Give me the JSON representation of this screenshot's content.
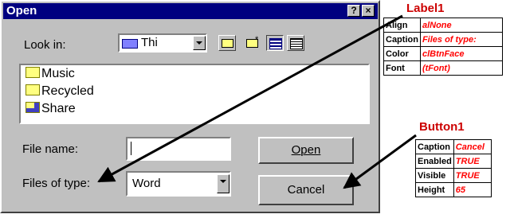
{
  "dialog": {
    "title": "Open",
    "help_glyph": "?",
    "close_glyph": "×",
    "look_in_label": "Look in:",
    "look_in_value": "Thi",
    "folders": [
      {
        "label": "Music",
        "icon": "folder-icon"
      },
      {
        "label": "Recycled",
        "icon": "folder-icon"
      },
      {
        "label": "Share",
        "icon": "shared-folder-icon"
      }
    ],
    "file_name_label": "File name:",
    "file_name_value": "",
    "files_of_type_label": "Files of type:",
    "files_of_type_value": "Word",
    "open_button": "Open",
    "cancel_button": "Cancel"
  },
  "label1": {
    "title": "Label1",
    "rows": [
      {
        "key": "Align",
        "value": "alNone"
      },
      {
        "key": "Caption",
        "value": "Files of type:"
      },
      {
        "key": "Color",
        "value": "clBtnFace"
      },
      {
        "key": "Font",
        "value": "(tFont)"
      }
    ]
  },
  "button1": {
    "title": "Button1",
    "rows": [
      {
        "key": "Caption",
        "value": "Cancel"
      },
      {
        "key": "Enabled",
        "value": "TRUE"
      },
      {
        "key": "Visible",
        "value": "TRUE"
      },
      {
        "key": "Height",
        "value": "65"
      }
    ]
  },
  "colors": {
    "titlebar": "#000080",
    "face": "#c0c0c0",
    "callout_text": "#ff0000",
    "arrow": "#000000"
  }
}
